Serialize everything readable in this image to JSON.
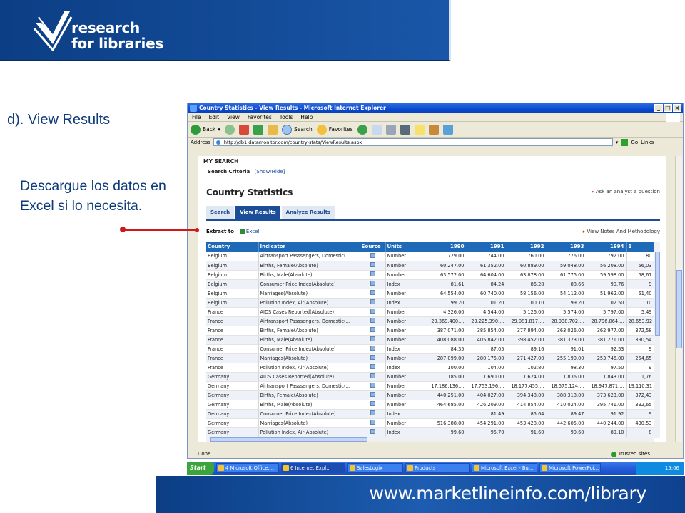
{
  "slide": {
    "logo_line1": "research",
    "logo_line2": "for libraries",
    "title": "d). View Results",
    "note": "Descargue los datos en Excel si lo necesita.",
    "footer_url": "www.marketlineinfo.com/library"
  },
  "window": {
    "title": "Country Statistics - View Results - Microsoft Internet Explorer",
    "menu": [
      "File",
      "Edit",
      "View",
      "Favorites",
      "Tools",
      "Help"
    ],
    "toolbar": {
      "back": "Back",
      "search": "Search",
      "favorites": "Favorites"
    },
    "address_label": "Address",
    "address_value": "http://db1.datamonitor.com/country-stats/ViewResults.aspx",
    "go_label": "Go",
    "links_label": "Links",
    "status_text": "Done",
    "zone_text": "Trusted sites"
  },
  "page": {
    "my_search": "MY SEARCH",
    "criteria_label": "Search Criteria",
    "show_hide": "[Show/Hide]",
    "heading": "Country Statistics",
    "ask_link": "Ask an analyst a question",
    "tabs": [
      "Search",
      "View Results",
      "Analyze Results"
    ],
    "active_tab": "View Results",
    "extract_label": "Extract to",
    "excel_link": "Excel",
    "notes_link": "View Notes And Methodology"
  },
  "table": {
    "headers": [
      "Country",
      "Indicator",
      "Source",
      "Units",
      "1990",
      "1991",
      "1992",
      "1993",
      "1994",
      "1"
    ],
    "rows": [
      [
        "Belgium",
        "Airtransport Passsengers, Domestic(...",
        "Number",
        "729.00",
        "744.00",
        "760.00",
        "776.00",
        "792.00",
        "80"
      ],
      [
        "Belgium",
        "Births, Female(Absolute)",
        "Number",
        "60,247.00",
        "61,352.00",
        "60,889.00",
        "59,048.00",
        "56,208.00",
        "56,03"
      ],
      [
        "Belgium",
        "Births, Male(Absolute)",
        "Number",
        "63,572.00",
        "64,604.00",
        "63,878.00",
        "61,775.00",
        "59,598.00",
        "58,61"
      ],
      [
        "Belgium",
        "Consumer Price Index(Absolute)",
        "Index",
        "81.61",
        "84.24",
        "86.28",
        "88.66",
        "90.76",
        "9"
      ],
      [
        "Belgium",
        "Marriages(Absolute)",
        "Number",
        "64,554.00",
        "60,740.00",
        "58,156.00",
        "54,112.00",
        "51,962.00",
        "51,40"
      ],
      [
        "Belgium",
        "Pollution Index, Air(Absolute)",
        "Index",
        "99.20",
        "101.20",
        "100.10",
        "99.20",
        "102.50",
        "10"
      ],
      [
        "France",
        "AIDS Cases Reported(Absolute)",
        "Number",
        "4,326.00",
        "4,544.00",
        "5,126.00",
        "5,574.00",
        "5,797.00",
        "5,49"
      ],
      [
        "France",
        "Airtransport Passsengers, Domestic(...",
        "Number",
        "29,369,400....",
        "29,225,390....",
        "29,081,817....",
        "28,938,702....",
        "28,796,064....",
        "28,653,92"
      ],
      [
        "France",
        "Births, Female(Absolute)",
        "Number",
        "387,071.00",
        "385,854.00",
        "377,894.00",
        "363,026.00",
        "362,977.00",
        "372,58"
      ],
      [
        "France",
        "Births, Male(Absolute)",
        "Number",
        "408,088.00",
        "405,842.00",
        "398,452.00",
        "381,323.00",
        "381,271.00",
        "390,54"
      ],
      [
        "France",
        "Consumer Price Index(Absolute)",
        "Index",
        "84.35",
        "87.05",
        "89.16",
        "91.01",
        "92.53",
        "9"
      ],
      [
        "France",
        "Marriages(Absolute)",
        "Number",
        "287,099.00",
        "280,175.00",
        "271,427.00",
        "255,190.00",
        "253,746.00",
        "254,65"
      ],
      [
        "France",
        "Pollution Index, Air(Absolute)",
        "Index",
        "100.00",
        "104.00",
        "102.80",
        "98.30",
        "97.50",
        "9"
      ],
      [
        "Germany",
        "AIDS Cases Reported(Absolute)",
        "Number",
        "1,185.00",
        "1,690.00",
        "1,624.00",
        "1,836.00",
        "1,843.00",
        "1,76"
      ],
      [
        "Germany",
        "Airtransport Passsengers, Domestic(...",
        "Number",
        "17,186,136....",
        "17,753,196....",
        "18,177,455....",
        "18,575,124....",
        "18,947,871....",
        "19,110,31"
      ],
      [
        "Germany",
        "Births, Female(Absolute)",
        "Number",
        "440,251.00",
        "404,027.00",
        "394,348.00",
        "388,318.00",
        "373,623.00",
        "372,43"
      ],
      [
        "Germany",
        "Births, Male(Absolute)",
        "Number",
        "464,685.00",
        "426,209.00",
        "414,854.00",
        "410,024.00",
        "395,741.00",
        "392,65"
      ],
      [
        "Germany",
        "Consumer Price Index(Absolute)",
        "Index",
        "",
        "81.49",
        "85.64",
        "89.47",
        "91.92",
        "9"
      ],
      [
        "Germany",
        "Marriages(Absolute)",
        "Number",
        "516,388.00",
        "454,291.00",
        "453,428.00",
        "442,605.00",
        "440,244.00",
        "430,53"
      ],
      [
        "Germany",
        "Pollution Index, Air(Absolute)",
        "Index",
        "99.60",
        "95.70",
        "91.60",
        "90.60",
        "89.10",
        "8"
      ]
    ]
  },
  "taskbar": {
    "start": "Start",
    "tasks": [
      "4 Microsoft Office....",
      "6 Internet Expl...",
      "SalesLogix",
      "Products",
      "Microsoft Excel - Bu...",
      "Microsoft PowerPoi..."
    ],
    "clock": "15:06"
  }
}
